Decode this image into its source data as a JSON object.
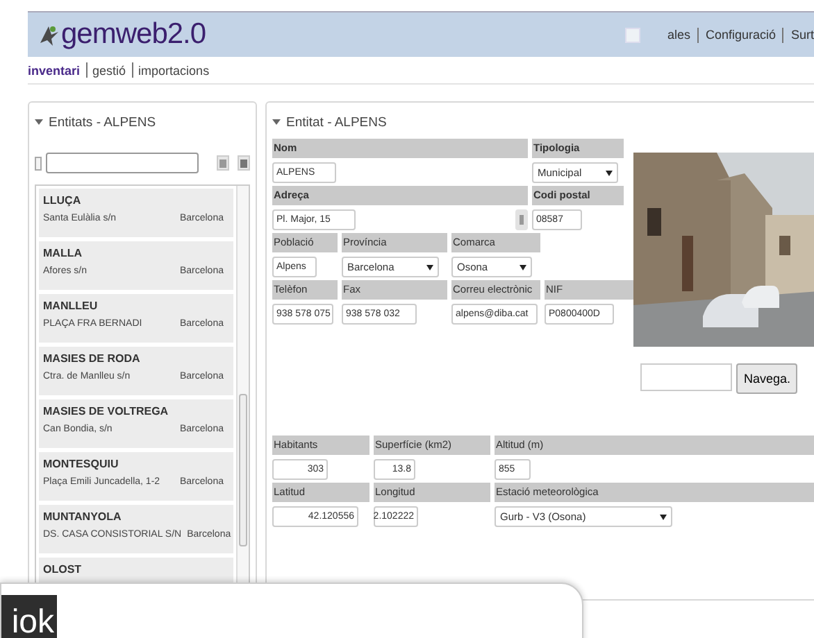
{
  "header": {
    "logo": "gemweb2.0",
    "user": "ales",
    "links": [
      "Configuració",
      "Surt"
    ]
  },
  "nav": [
    {
      "label": "inventari",
      "selected": true
    },
    {
      "label": "gestió",
      "selected": false
    },
    {
      "label": "importacions",
      "selected": false
    }
  ],
  "entities_panel": {
    "title": "Entitats - ALPENS",
    "expanded": true,
    "select_all_checked": false,
    "items": [
      {
        "name": "LLUÇA",
        "address": "Santa Eulàlia s/n",
        "province": "Barcelona"
      },
      {
        "name": "MALLA",
        "address": "Afores s/n",
        "province": "Barcelona"
      },
      {
        "name": "MANLLEU",
        "address": "PLAÇA FRA BERNADI",
        "province": "Barcelona"
      },
      {
        "name": "MASIES DE RODA",
        "address": "Ctra. de Manlleu s/n",
        "province": "Barcelona"
      },
      {
        "name": "MASIES DE VOLTREGA",
        "address": "Can Bondia, s/n",
        "province": "Barcelona"
      },
      {
        "name": "MONTESQUIU",
        "address": "Plaça Emili Juncadella, 1-2",
        "province": "Barcelona"
      },
      {
        "name": "MUNTANYOLA",
        "address": "DS. CASA CONSISTORIAL S/N",
        "province": "Barcelona"
      },
      {
        "name": "OLOST"
      }
    ]
  },
  "entity_panel": {
    "title": "Entitat - ALPENS",
    "expanded": true,
    "rows": [
      {
        "bold": true,
        "cells": [
          {
            "label": "Nom",
            "value": "ALPENS",
            "kind": "text"
          },
          {
            "label": "Tipologia",
            "value": "Municipal",
            "kind": "select"
          }
        ]
      },
      {
        "bold": true,
        "cells": [
          {
            "label": "Adreça",
            "value": "Pl. Major, 15",
            "kind": "text"
          },
          {
            "label": "Codi postal",
            "value": "08587",
            "kind": "text"
          }
        ]
      },
      {
        "bold": false,
        "cells": [
          {
            "label": "Població",
            "value": "Alpens",
            "kind": "text"
          },
          {
            "label": "Província",
            "value": "Barcelona",
            "kind": "select"
          },
          {
            "label": "Comarca",
            "value": "Osona",
            "kind": "select"
          }
        ]
      },
      {
        "bold": false,
        "cells": [
          {
            "label": "Telèfon",
            "value": "938 578 075",
            "kind": "text"
          },
          {
            "label": "Fax",
            "value": "938 578 032",
            "kind": "text"
          },
          {
            "label": "Correu electrònic",
            "value": "alpens@diba.cat",
            "kind": "text"
          },
          {
            "label": "NIF",
            "value": "P0800400D",
            "kind": "text"
          }
        ]
      }
    ],
    "lower_rows": [
      {
        "bold": false,
        "cells": [
          {
            "label": "Habitants",
            "value": "303",
            "kind": "number"
          },
          {
            "label": "Superfície (km2)",
            "value": "13.8",
            "kind": "number"
          },
          {
            "label": "Altitud (m)",
            "value": "855",
            "kind": "text"
          }
        ]
      },
      {
        "bold": false,
        "cells": [
          {
            "label": "Latitud",
            "value": "42.120556",
            "kind": "number"
          },
          {
            "label": "Longitud",
            "value": "2.102222",
            "kind": "number"
          },
          {
            "label": "Estació meteorològica",
            "value": "Gurb - V3 (Osona)",
            "kind": "select"
          }
        ]
      }
    ],
    "navigate_button": "Navega."
  },
  "overlay_window": {
    "logo": "iok"
  }
}
